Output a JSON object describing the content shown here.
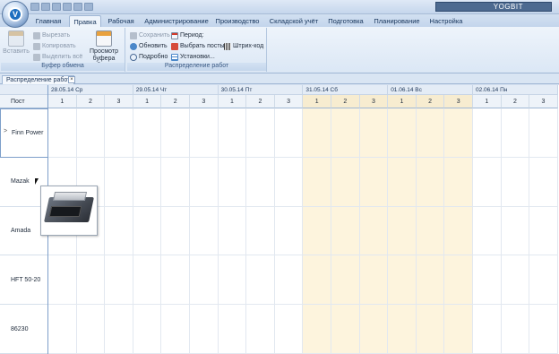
{
  "app": {
    "title": "YOGBIT",
    "logo_icon": "app-logo-icon"
  },
  "ribbon_tabs": [
    "Главная",
    "Правка",
    "Рабочая",
    "Администрирование",
    "Производство",
    "Складской учёт",
    "Подготовка",
    "Планирование",
    "Настройка"
  ],
  "active_tab": "Правка",
  "clipboard_group": {
    "label": "Буфер обмена",
    "paste": "Вставить",
    "cut": "Вырезать",
    "copy": "Копировать",
    "select_all": "Выделить всё",
    "view_clipboard": "Просмотр буфера обмена"
  },
  "work_group": {
    "label": "Распределение работ",
    "save": "Сохранить",
    "refresh": "Обновить",
    "details": "Подробно",
    "period": "Период:",
    "select_posts": "Выбрать посты",
    "barcode": "Штрих-код",
    "settings": "Установки..."
  },
  "document_tab": "Распределение работ",
  "grid": {
    "post_header": "Пост",
    "dates": [
      "28.05.14 Ср",
      "29.05.14 Чт",
      "30.05.14 Пт",
      "31.05.14 Сб",
      "01.06.14 Вс",
      "02.06.14 Пн"
    ],
    "weekend_flags": [
      false,
      false,
      false,
      true,
      true,
      false
    ],
    "shifts": [
      "1",
      "2",
      "3"
    ],
    "posts": [
      "Finn Power",
      "Mazak",
      "Amada",
      "HFT 50-20",
      "86230"
    ],
    "selected_row_marker": ">"
  },
  "colors": {
    "weekend_fill": "#fdf4dd",
    "ribbon_bg": "#dbe7f5",
    "accent_blue": "#1e6fc0"
  }
}
